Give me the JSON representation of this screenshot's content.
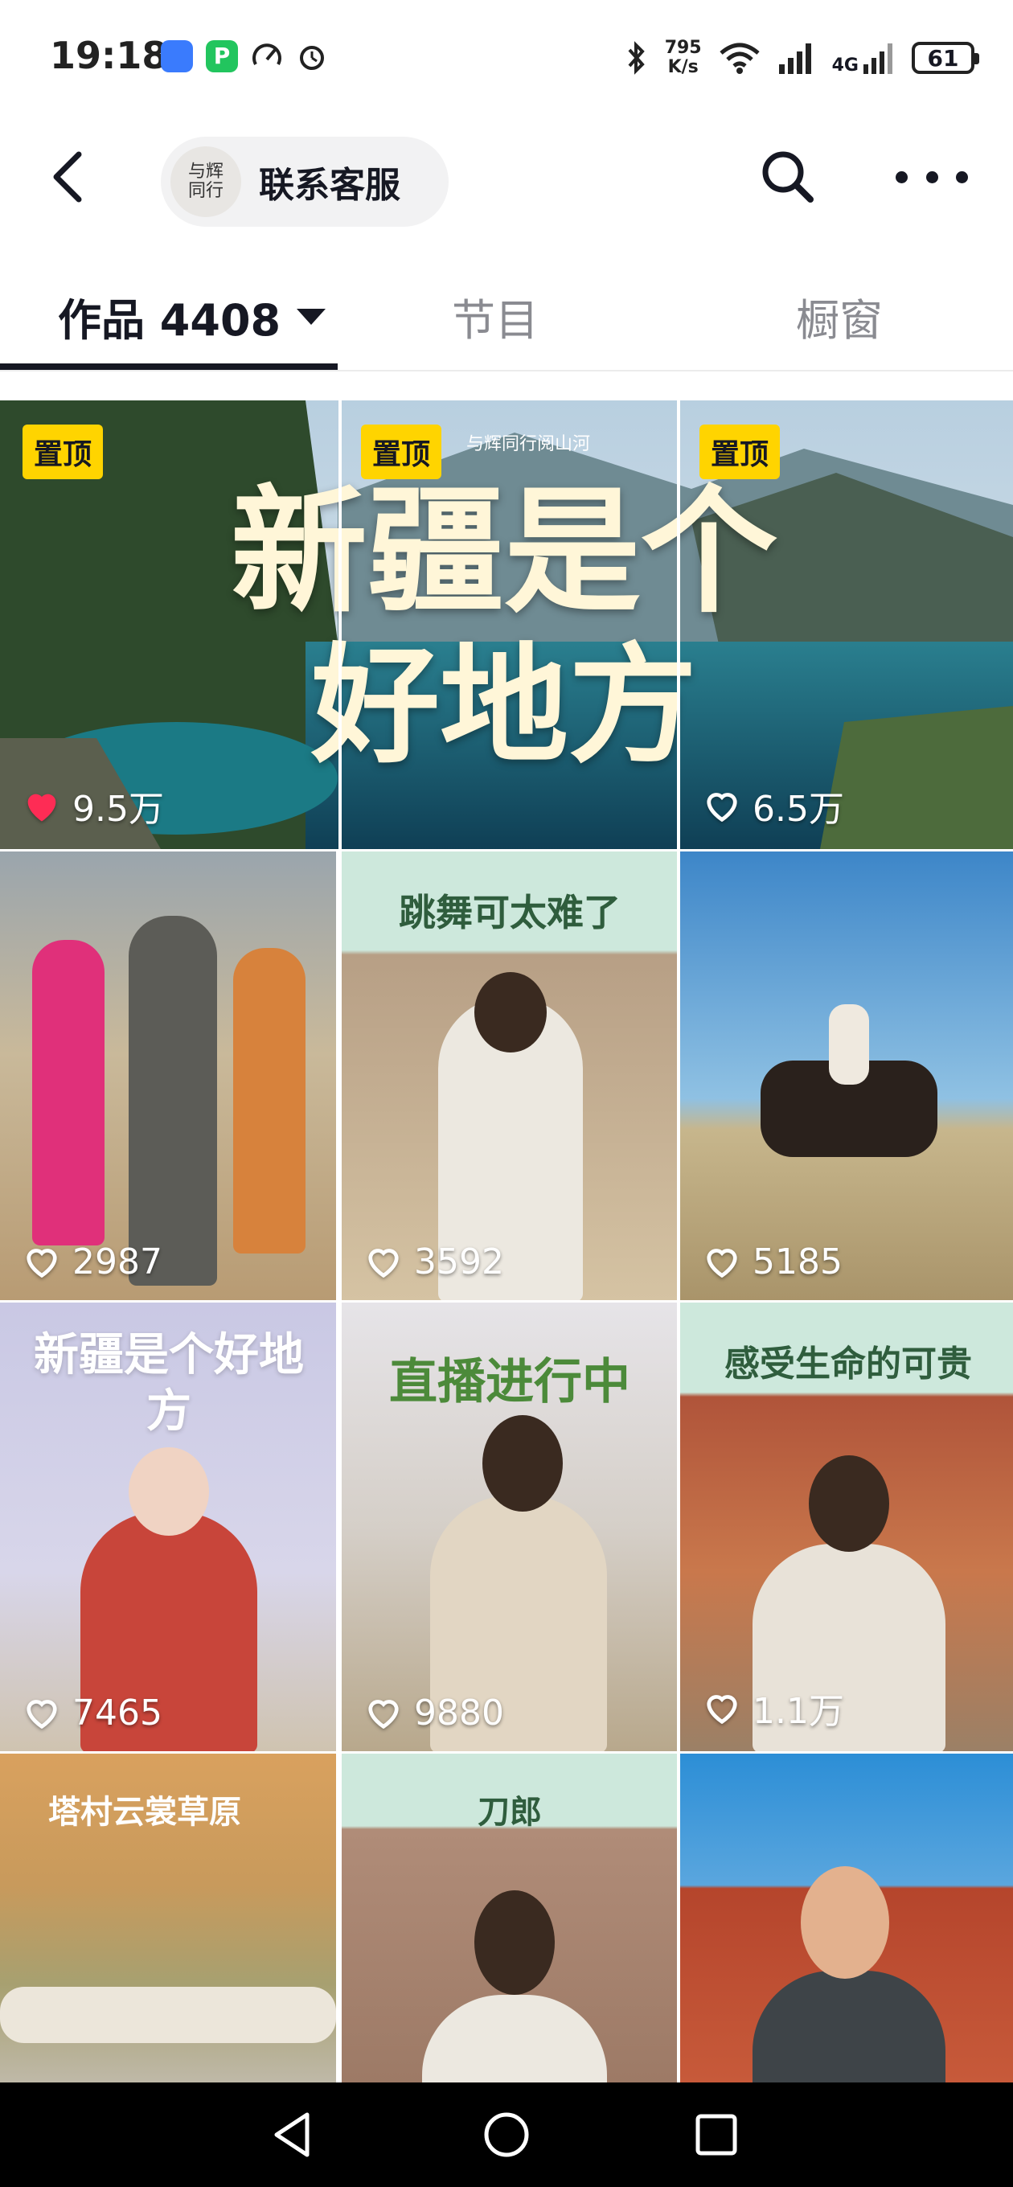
{
  "status_bar": {
    "time": "19:18",
    "net_speed_value": "795",
    "net_speed_unit": "K/s",
    "network": "4G",
    "battery": "61",
    "icons": [
      "clock-app-icon",
      "parking-app-icon",
      "speed-icon",
      "alarm-icon",
      "bluetooth-icon",
      "wifi-icon",
      "signal-icon"
    ]
  },
  "header": {
    "account_logo_text": "与辉同行",
    "contact_label": "联系客服"
  },
  "tabs": [
    {
      "label": "作品 4408",
      "active": true
    },
    {
      "label": "节目",
      "active": false
    },
    {
      "label": "橱窗",
      "active": false
    }
  ],
  "banner": {
    "line1": "新疆是个",
    "line2": "好地方",
    "watermark": "与辉同行阅山河"
  },
  "grid": [
    {
      "pinned": true,
      "pin_label": "置顶",
      "likes": "9.5万",
      "liked": true
    },
    {
      "pinned": true,
      "pin_label": "置顶",
      "likes": "",
      "liked": false
    },
    {
      "pinned": true,
      "pin_label": "置顶",
      "likes": "6.5万",
      "liked": false
    },
    {
      "pinned": false,
      "likes": "2987",
      "liked": false
    },
    {
      "pinned": false,
      "likes": "3592",
      "liked": false,
      "title": "跳舞可太难了"
    },
    {
      "pinned": false,
      "likes": "5185",
      "liked": false
    },
    {
      "pinned": false,
      "likes": "7465",
      "liked": false,
      "title": "新疆是个好地方"
    },
    {
      "pinned": false,
      "likes": "9880",
      "liked": false,
      "title": "直播进行中"
    },
    {
      "pinned": false,
      "likes": "1.1万",
      "liked": false,
      "title": "感受生命的可贵"
    },
    {
      "pinned": false,
      "likes": "",
      "liked": false,
      "title": "塔村云裳草原"
    },
    {
      "pinned": false,
      "likes": "",
      "liked": false,
      "title": "刀郎"
    },
    {
      "pinned": false,
      "likes": "",
      "liked": false
    }
  ],
  "colors": {
    "pin_yellow": "#ffd400",
    "like_red": "#fe2c55",
    "text_primary": "#161823",
    "text_secondary": "#8a8b91"
  }
}
